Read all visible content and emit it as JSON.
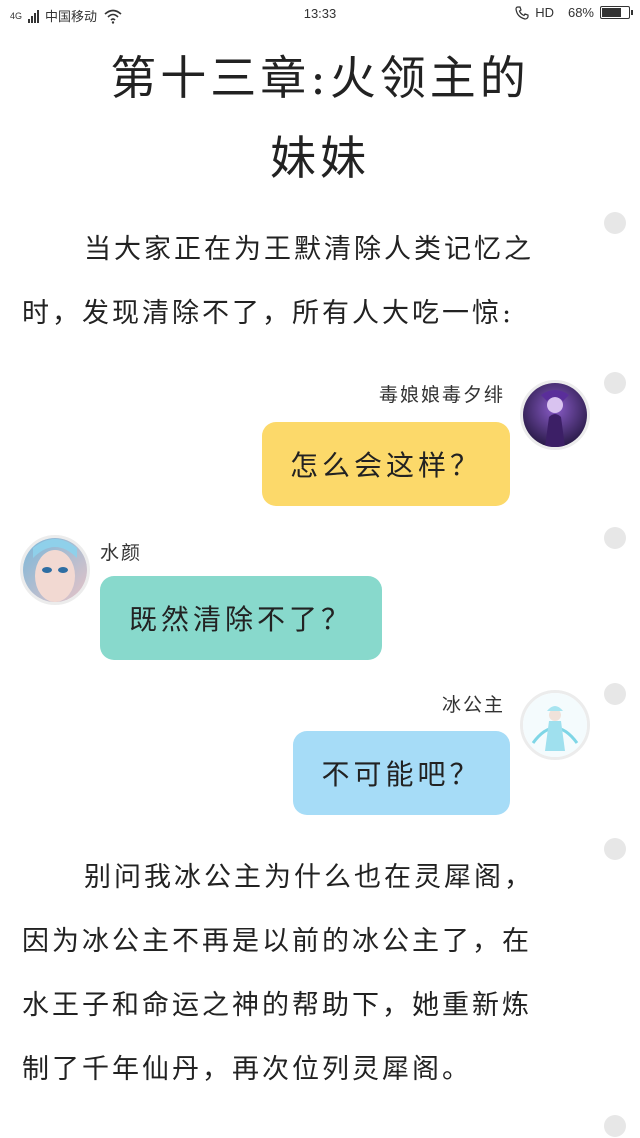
{
  "status": {
    "network": "4G",
    "carrier": "中国移动",
    "time": "13:33",
    "hd": "HD",
    "battery": "68%",
    "battery_level": 0.68
  },
  "chapter_title_line1": "第十三章:火领主的",
  "chapter_title_line2": "妹妹",
  "paragraph1": {
    "line1": "当大家正在为王默清除人类记忆之",
    "line2": "时，发现清除不了，所有人大吃一惊:"
  },
  "chat": [
    {
      "speaker": "毒娘娘毒夕绯",
      "text": "怎么会这样？",
      "side": "right",
      "color": "#fcd96a"
    },
    {
      "speaker": "水颜",
      "text": "既然清除不了？",
      "side": "left",
      "color": "#88d9cc"
    },
    {
      "speaker": "冰公主",
      "text": "不可能吧？",
      "side": "right",
      "color": "#a6dcf7"
    }
  ],
  "paragraph2": {
    "line1": "别问我冰公主为什么也在灵犀阁，",
    "line2": "因为冰公主不再是以前的冰公主了，在",
    "line3": "水王子和命运之神的帮助下，她重新炼",
    "line4": "制了千年仙丹，再次位列灵犀阁。"
  }
}
